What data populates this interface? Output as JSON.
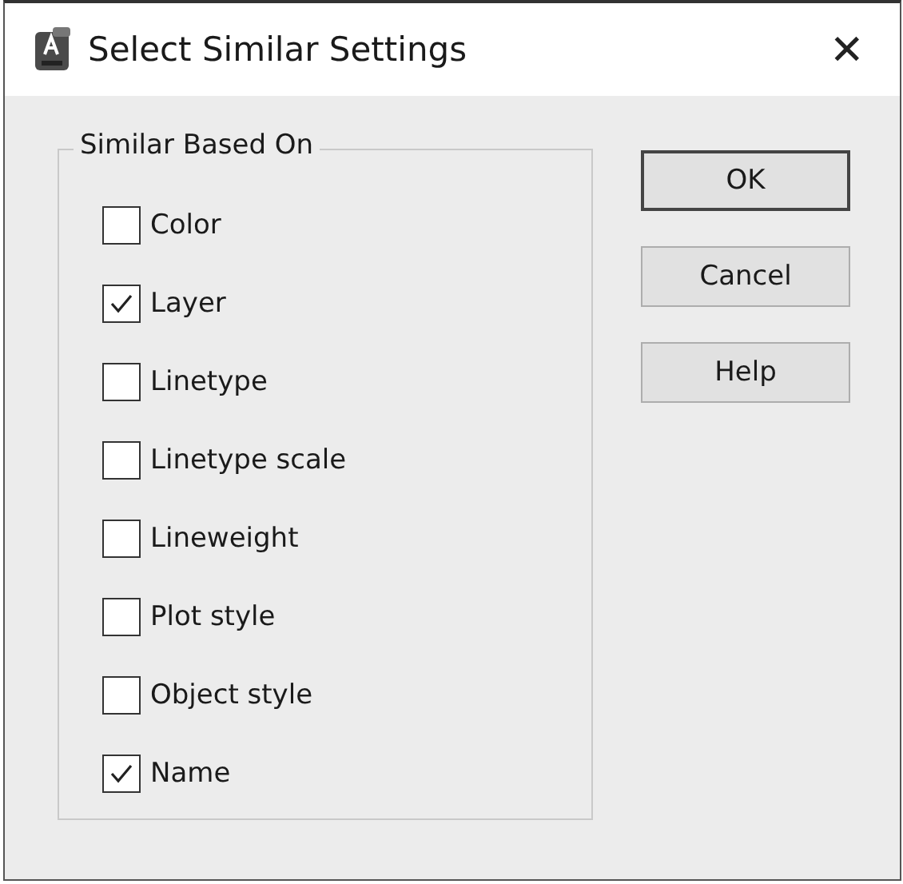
{
  "window": {
    "title": "Select Similar Settings",
    "close": "✕"
  },
  "group": {
    "title": "Similar Based On",
    "options": [
      {
        "label": "Color",
        "checked": false
      },
      {
        "label": "Layer",
        "checked": true
      },
      {
        "label": "Linetype",
        "checked": false
      },
      {
        "label": "Linetype scale",
        "checked": false
      },
      {
        "label": "Lineweight",
        "checked": false
      },
      {
        "label": "Plot style",
        "checked": false
      },
      {
        "label": "Object style",
        "checked": false
      },
      {
        "label": "Name",
        "checked": true
      }
    ]
  },
  "buttons": [
    {
      "label": "OK",
      "default": true
    },
    {
      "label": "Cancel",
      "default": false
    },
    {
      "label": "Help",
      "default": false
    }
  ]
}
